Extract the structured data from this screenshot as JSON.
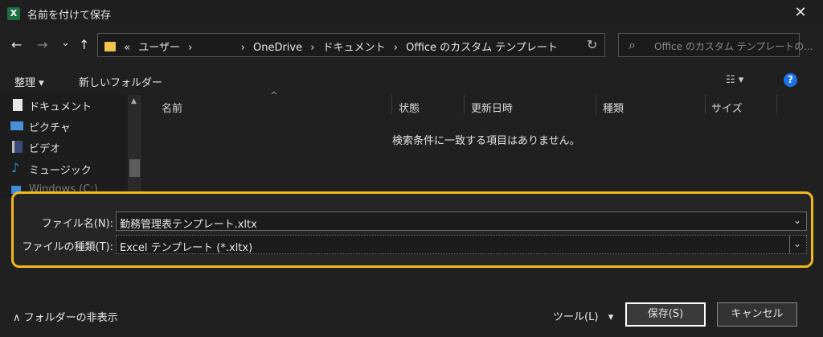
{
  "window": {
    "title": "名前を付けて保存",
    "close_glyph": "✕"
  },
  "nav": {
    "back_glyph": "←",
    "forward_glyph": "→",
    "recent_glyph": "⌄",
    "up_glyph": "↑"
  },
  "address": {
    "breadcrumbs": [
      "«",
      "ユーザー",
      "›",
      "",
      "›",
      "OneDrive",
      "›",
      "ドキュメント",
      "›",
      "Office のカスタム テンプレート"
    ],
    "refresh_glyph": "↻"
  },
  "search": {
    "placeholder": "Office のカスタム テンプレートの...",
    "icon_glyph": "⌕"
  },
  "toolbar": {
    "organize_label": "整理 ▾",
    "new_folder_label": "新しいフォルダー",
    "view_glyph": "☷ ▾",
    "help_glyph": "?"
  },
  "sidebar": {
    "items": [
      {
        "label": "ドキュメント",
        "icon": "document-icon"
      },
      {
        "label": "ピクチャ",
        "icon": "pictures-icon"
      },
      {
        "label": "ビデオ",
        "icon": "video-icon"
      },
      {
        "label": "ミュージック",
        "icon": "music-icon"
      },
      {
        "label": "Windows (C:)",
        "icon": "drive-icon"
      }
    ]
  },
  "file_list": {
    "columns": [
      "名前",
      "状態",
      "更新日時",
      "種類",
      "サイズ"
    ],
    "sort_glyph": "^",
    "empty_message": "検索条件に一致する項目はありません。"
  },
  "save_panel": {
    "filename_label": "ファイル名(N):",
    "filename_value": "勤務管理表テンプレート.xltx",
    "filetype_label": "ファイルの種類(T):",
    "filetype_value": "Excel テンプレート (*.xltx)",
    "chevron_glyph": "⌄"
  },
  "footer": {
    "hide_folders_label": "∧ フォルダーの非表示",
    "tools_label": "ツール(L)   ▾",
    "save_label": "保存(S)",
    "cancel_label": "キャンセル"
  },
  "colors": {
    "accent_highlight": "#f2b91b",
    "background": "#202020",
    "excel_green": "#1d6f42"
  }
}
